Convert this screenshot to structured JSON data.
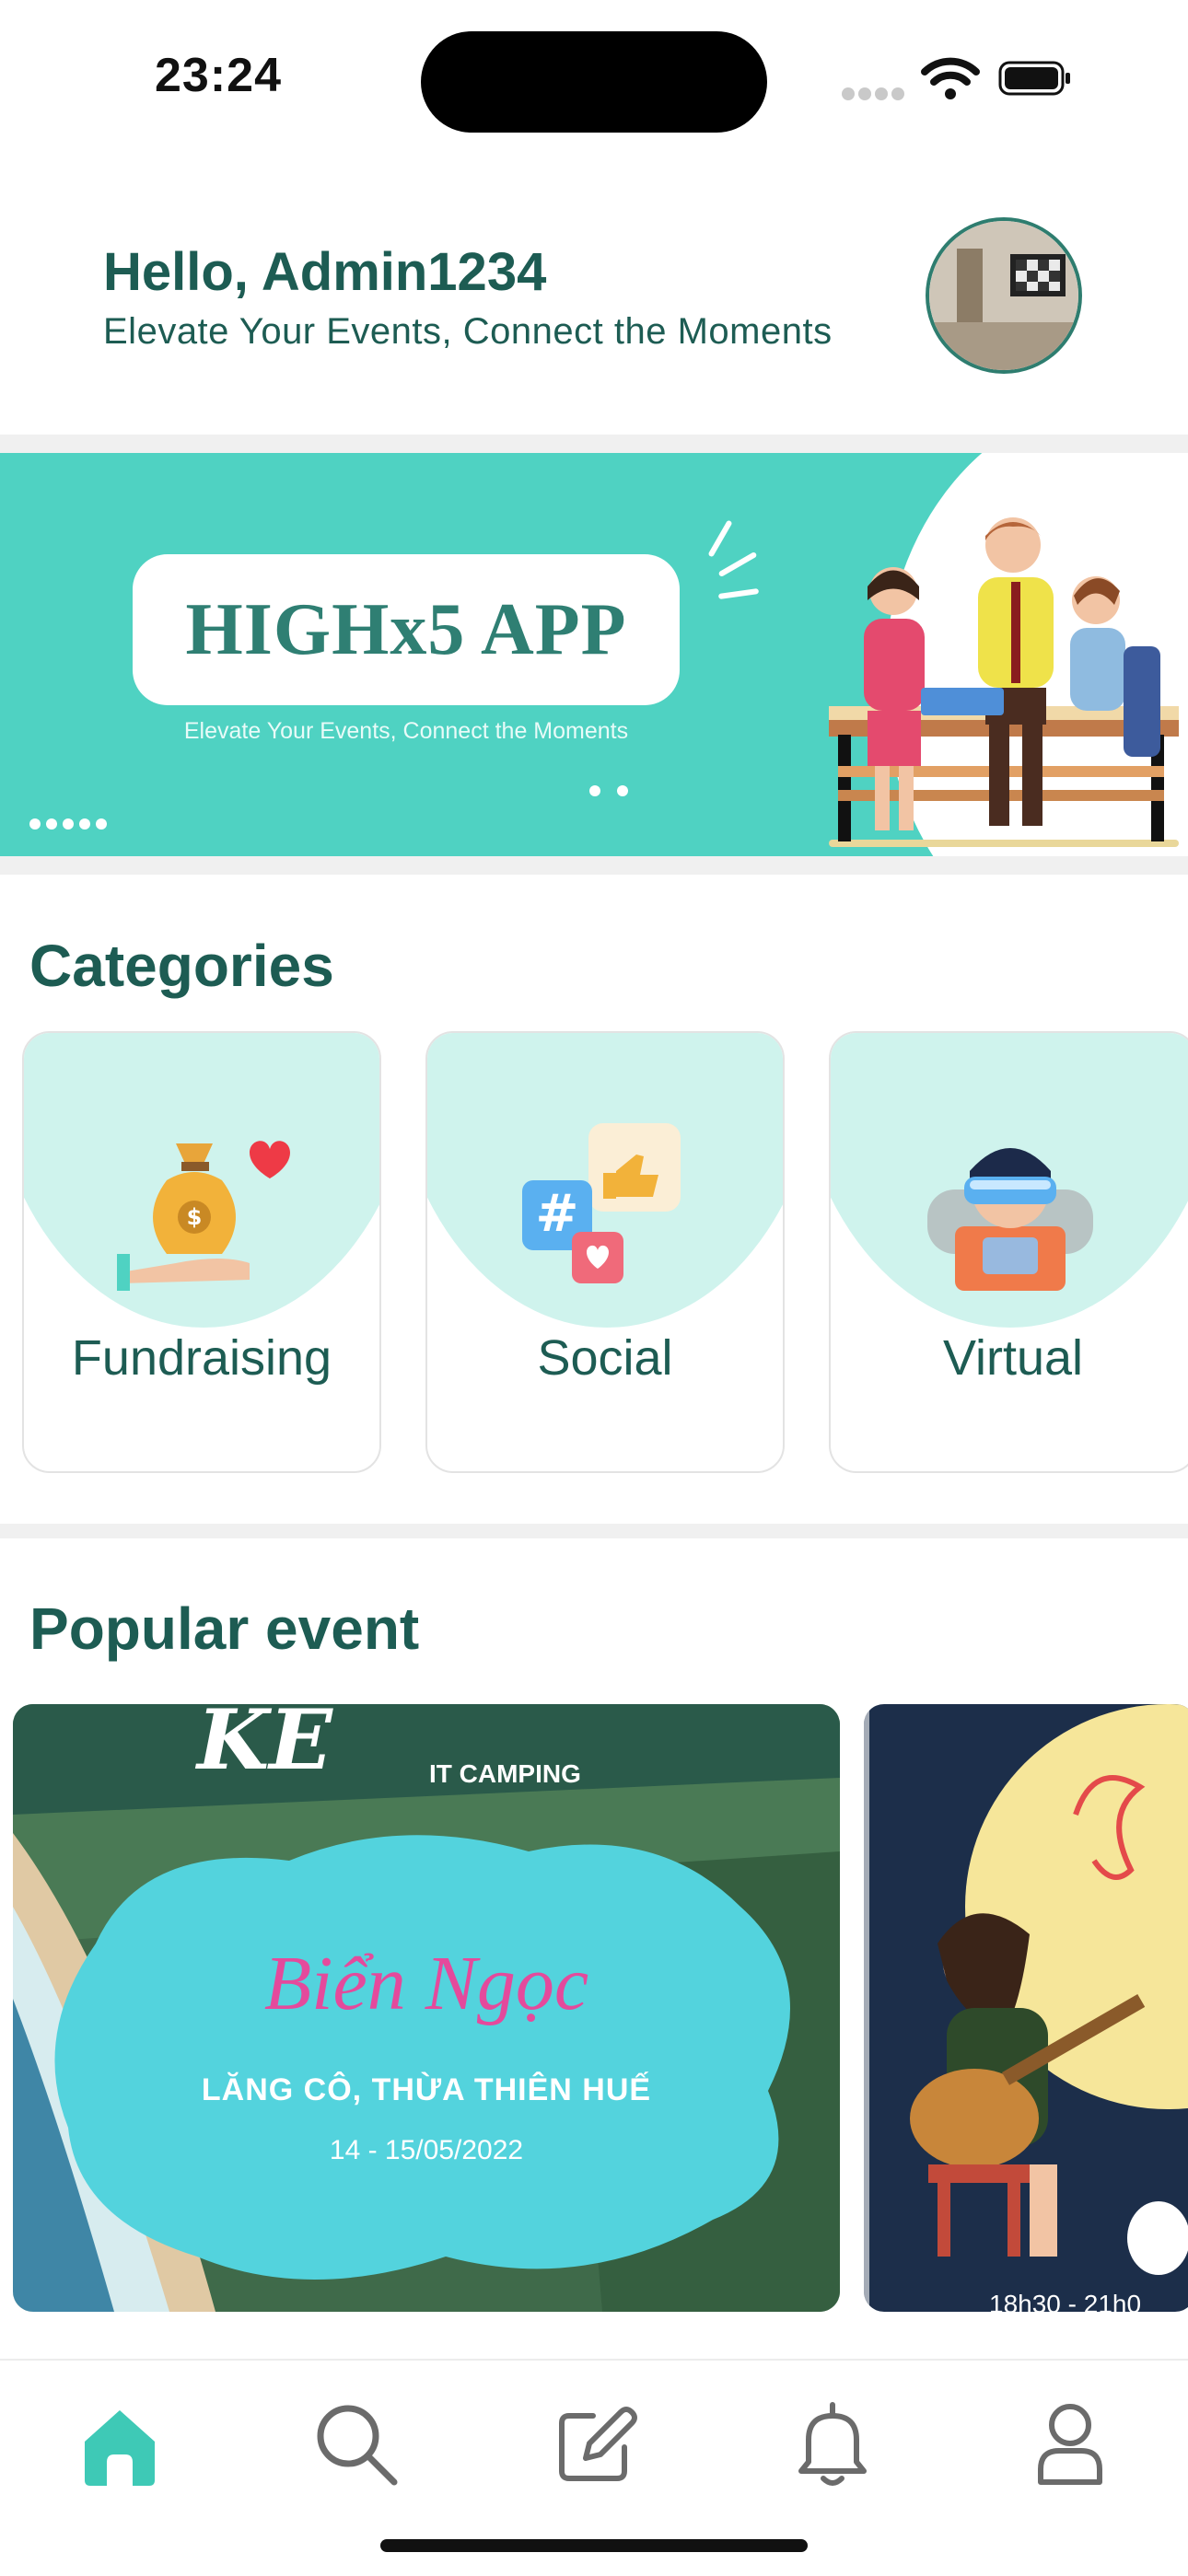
{
  "status_bar": {
    "time": "23:24"
  },
  "header": {
    "greeting": "Hello, Admin1234",
    "tagline": "Elevate Your Events, Connect the Moments"
  },
  "banner": {
    "title": "HIGHx5 APP",
    "subtitle": "Elevate Your Events, Connect the Moments",
    "bg_color": "#4fd2c2"
  },
  "categories": {
    "title": "Categories",
    "items": [
      {
        "label": "Fundraising",
        "icon": "money-bag-heart-icon"
      },
      {
        "label": "Social",
        "icon": "social-hashtag-like-icon"
      },
      {
        "label": "Virtual",
        "icon": "vr-headset-person-icon"
      }
    ]
  },
  "popular": {
    "title": "Popular event",
    "events": [
      {
        "tag": "IT CAMPING",
        "name": "Biển Ngọc",
        "location": "LĂNG CÔ, THỪA THIÊN HUẾ",
        "date": "14 - 15/05/2022"
      },
      {
        "tag": "",
        "name": "",
        "time_partial": "18h30 - 21h0"
      }
    ]
  },
  "nav": {
    "items": [
      {
        "name": "home",
        "icon": "home-icon",
        "active": true
      },
      {
        "name": "search",
        "icon": "search-icon",
        "active": false
      },
      {
        "name": "create",
        "icon": "edit-icon",
        "active": false
      },
      {
        "name": "notifications",
        "icon": "bell-icon",
        "active": false
      },
      {
        "name": "profile",
        "icon": "user-icon",
        "active": false
      }
    ],
    "accent": "#3ec9b6"
  },
  "colors": {
    "primary_text": "#1d5c53",
    "accent": "#4fd2c2",
    "light_mint": "#cff3ed"
  }
}
